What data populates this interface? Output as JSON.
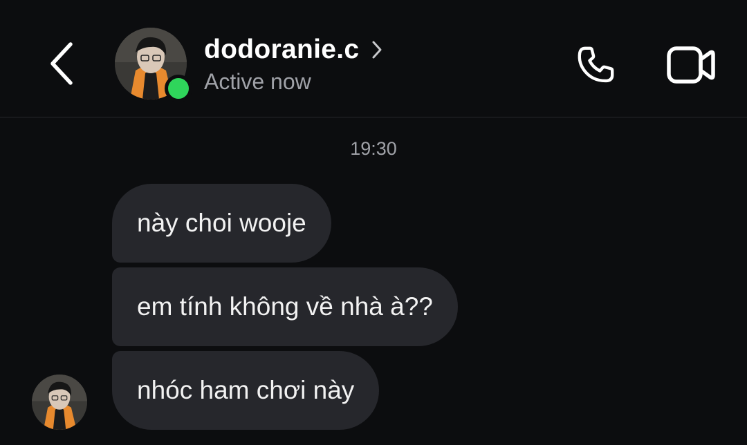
{
  "header": {
    "username": "dodoranie.c",
    "status": "Active now",
    "back_icon": "chevron-left-icon",
    "call_icon": "phone-icon",
    "video_icon": "video-camera-icon",
    "online_color": "#2fd55b"
  },
  "thread": {
    "timestamp": "19:30",
    "messages": [
      {
        "text": "này choi wooje"
      },
      {
        "text": "em tính không về nhà à??"
      },
      {
        "text": "nhóc ham chơi này"
      }
    ]
  },
  "colors": {
    "background": "#0c0d0f",
    "bubble": "#26272c",
    "secondary_text": "#a0a2a8"
  }
}
